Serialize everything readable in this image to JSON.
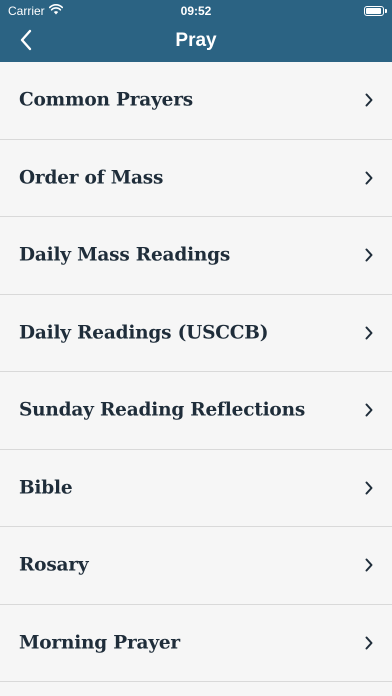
{
  "status_bar": {
    "carrier": "Carrier",
    "time": "09:52"
  },
  "nav": {
    "title": "Pray",
    "back_icon": "chevron-left-icon"
  },
  "menu": {
    "items": [
      {
        "label": "Common Prayers"
      },
      {
        "label": "Order of Mass"
      },
      {
        "label": "Daily Mass Readings"
      },
      {
        "label": "Daily Readings (USCCB)"
      },
      {
        "label": "Sunday Reading Reflections"
      },
      {
        "label": "Bible"
      },
      {
        "label": "Rosary"
      },
      {
        "label": "Morning Prayer"
      }
    ]
  },
  "colors": {
    "header_bg": "#2b6383",
    "list_bg": "#f6f6f6",
    "label_text": "#1f2d3a",
    "divider": "#d9d9d9"
  }
}
